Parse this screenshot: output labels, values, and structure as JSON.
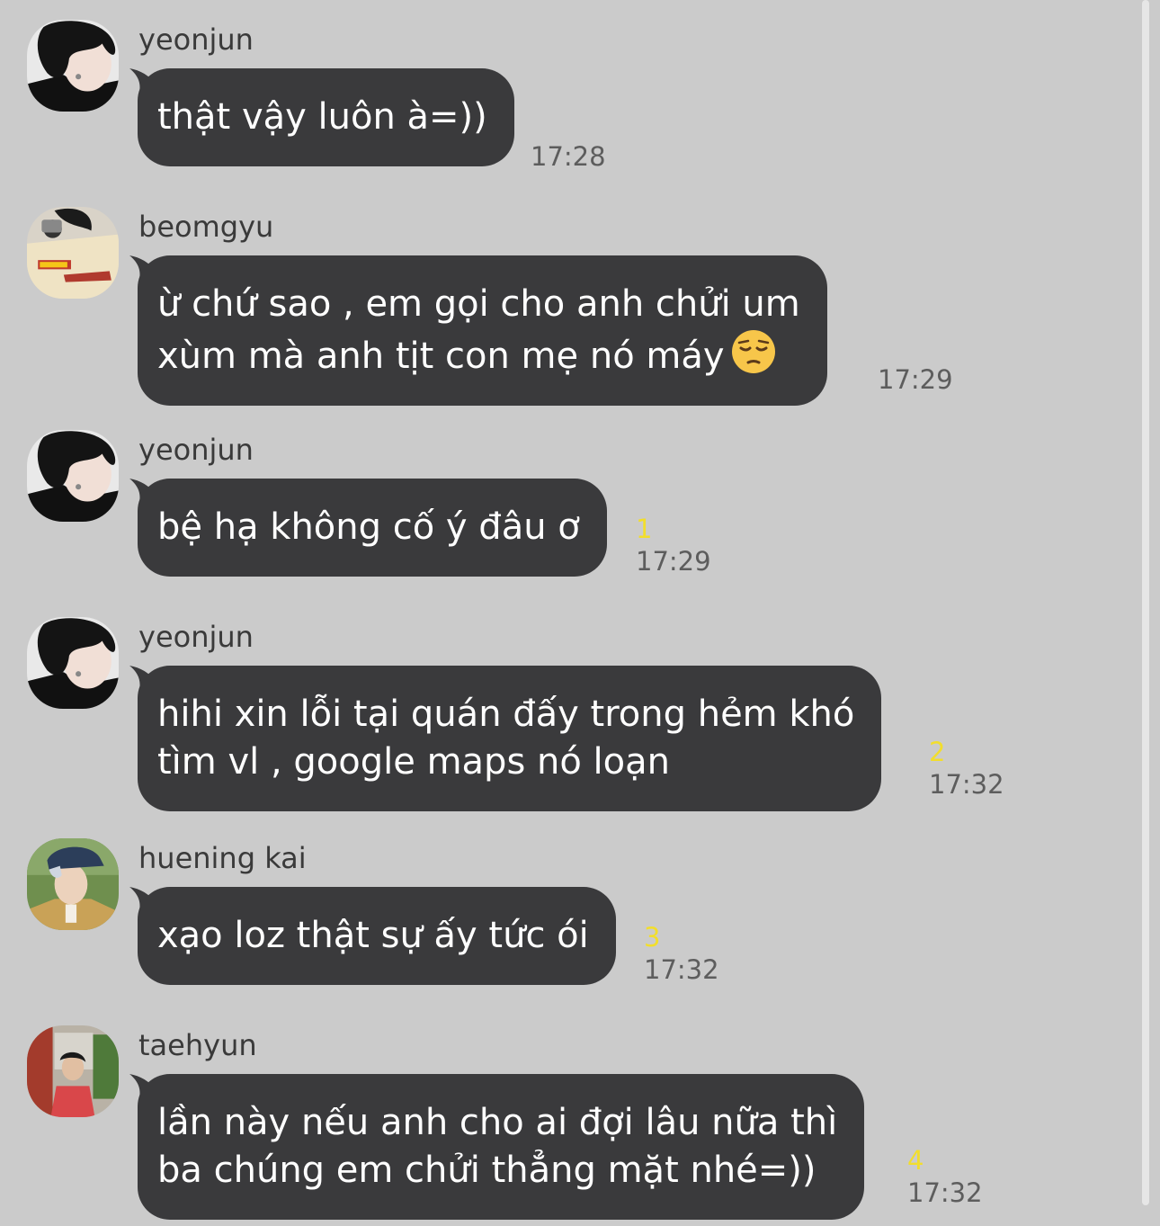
{
  "messages": [
    {
      "sender": "yeonjun",
      "lines": [
        "thật vậy luôn à=))"
      ],
      "unread": "",
      "time": "17:28",
      "avatar_icon": "avatar-yeonjun-icon"
    },
    {
      "sender": "beomgyu",
      "lines": [
        "ừ chứ sao , em gọi cho anh chửi um",
        "xùm mà anh tịt con mẹ nó máy"
      ],
      "emoji": "pensive-face-emoji",
      "unread": "",
      "time": "17:29",
      "avatar_icon": "avatar-beomgyu-icon"
    },
    {
      "sender": "yeonjun",
      "lines": [
        "bệ hạ không cố ý đâu ơ"
      ],
      "unread": "1",
      "time": "17:29",
      "avatar_icon": "avatar-yeonjun-icon"
    },
    {
      "sender": "yeonjun",
      "lines": [
        "hihi xin lỗi tại quán đấy trong hẻm khó",
        "tìm vl , google maps nó loạn"
      ],
      "unread": "2",
      "time": "17:32",
      "avatar_icon": "avatar-yeonjun-icon"
    },
    {
      "sender": "huening kai",
      "lines": [
        "xạo loz thật sự ấy tức ói"
      ],
      "unread": "3",
      "time": "17:32",
      "avatar_icon": "avatar-hueningkai-icon"
    },
    {
      "sender": "taehyun",
      "lines": [
        "lần này nếu anh cho ai đợi lâu nữa thì",
        "ba chúng em chửi thẳng mặt nhé=))"
      ],
      "unread": "4",
      "time": "17:32",
      "avatar_icon": "avatar-taehyun-icon"
    }
  ],
  "colors": {
    "background": "#cbcbcb",
    "bubble": "#3a3a3c",
    "bubble_text": "#ffffff",
    "unread": "#f2de2c",
    "time": "#5d5d5d"
  }
}
